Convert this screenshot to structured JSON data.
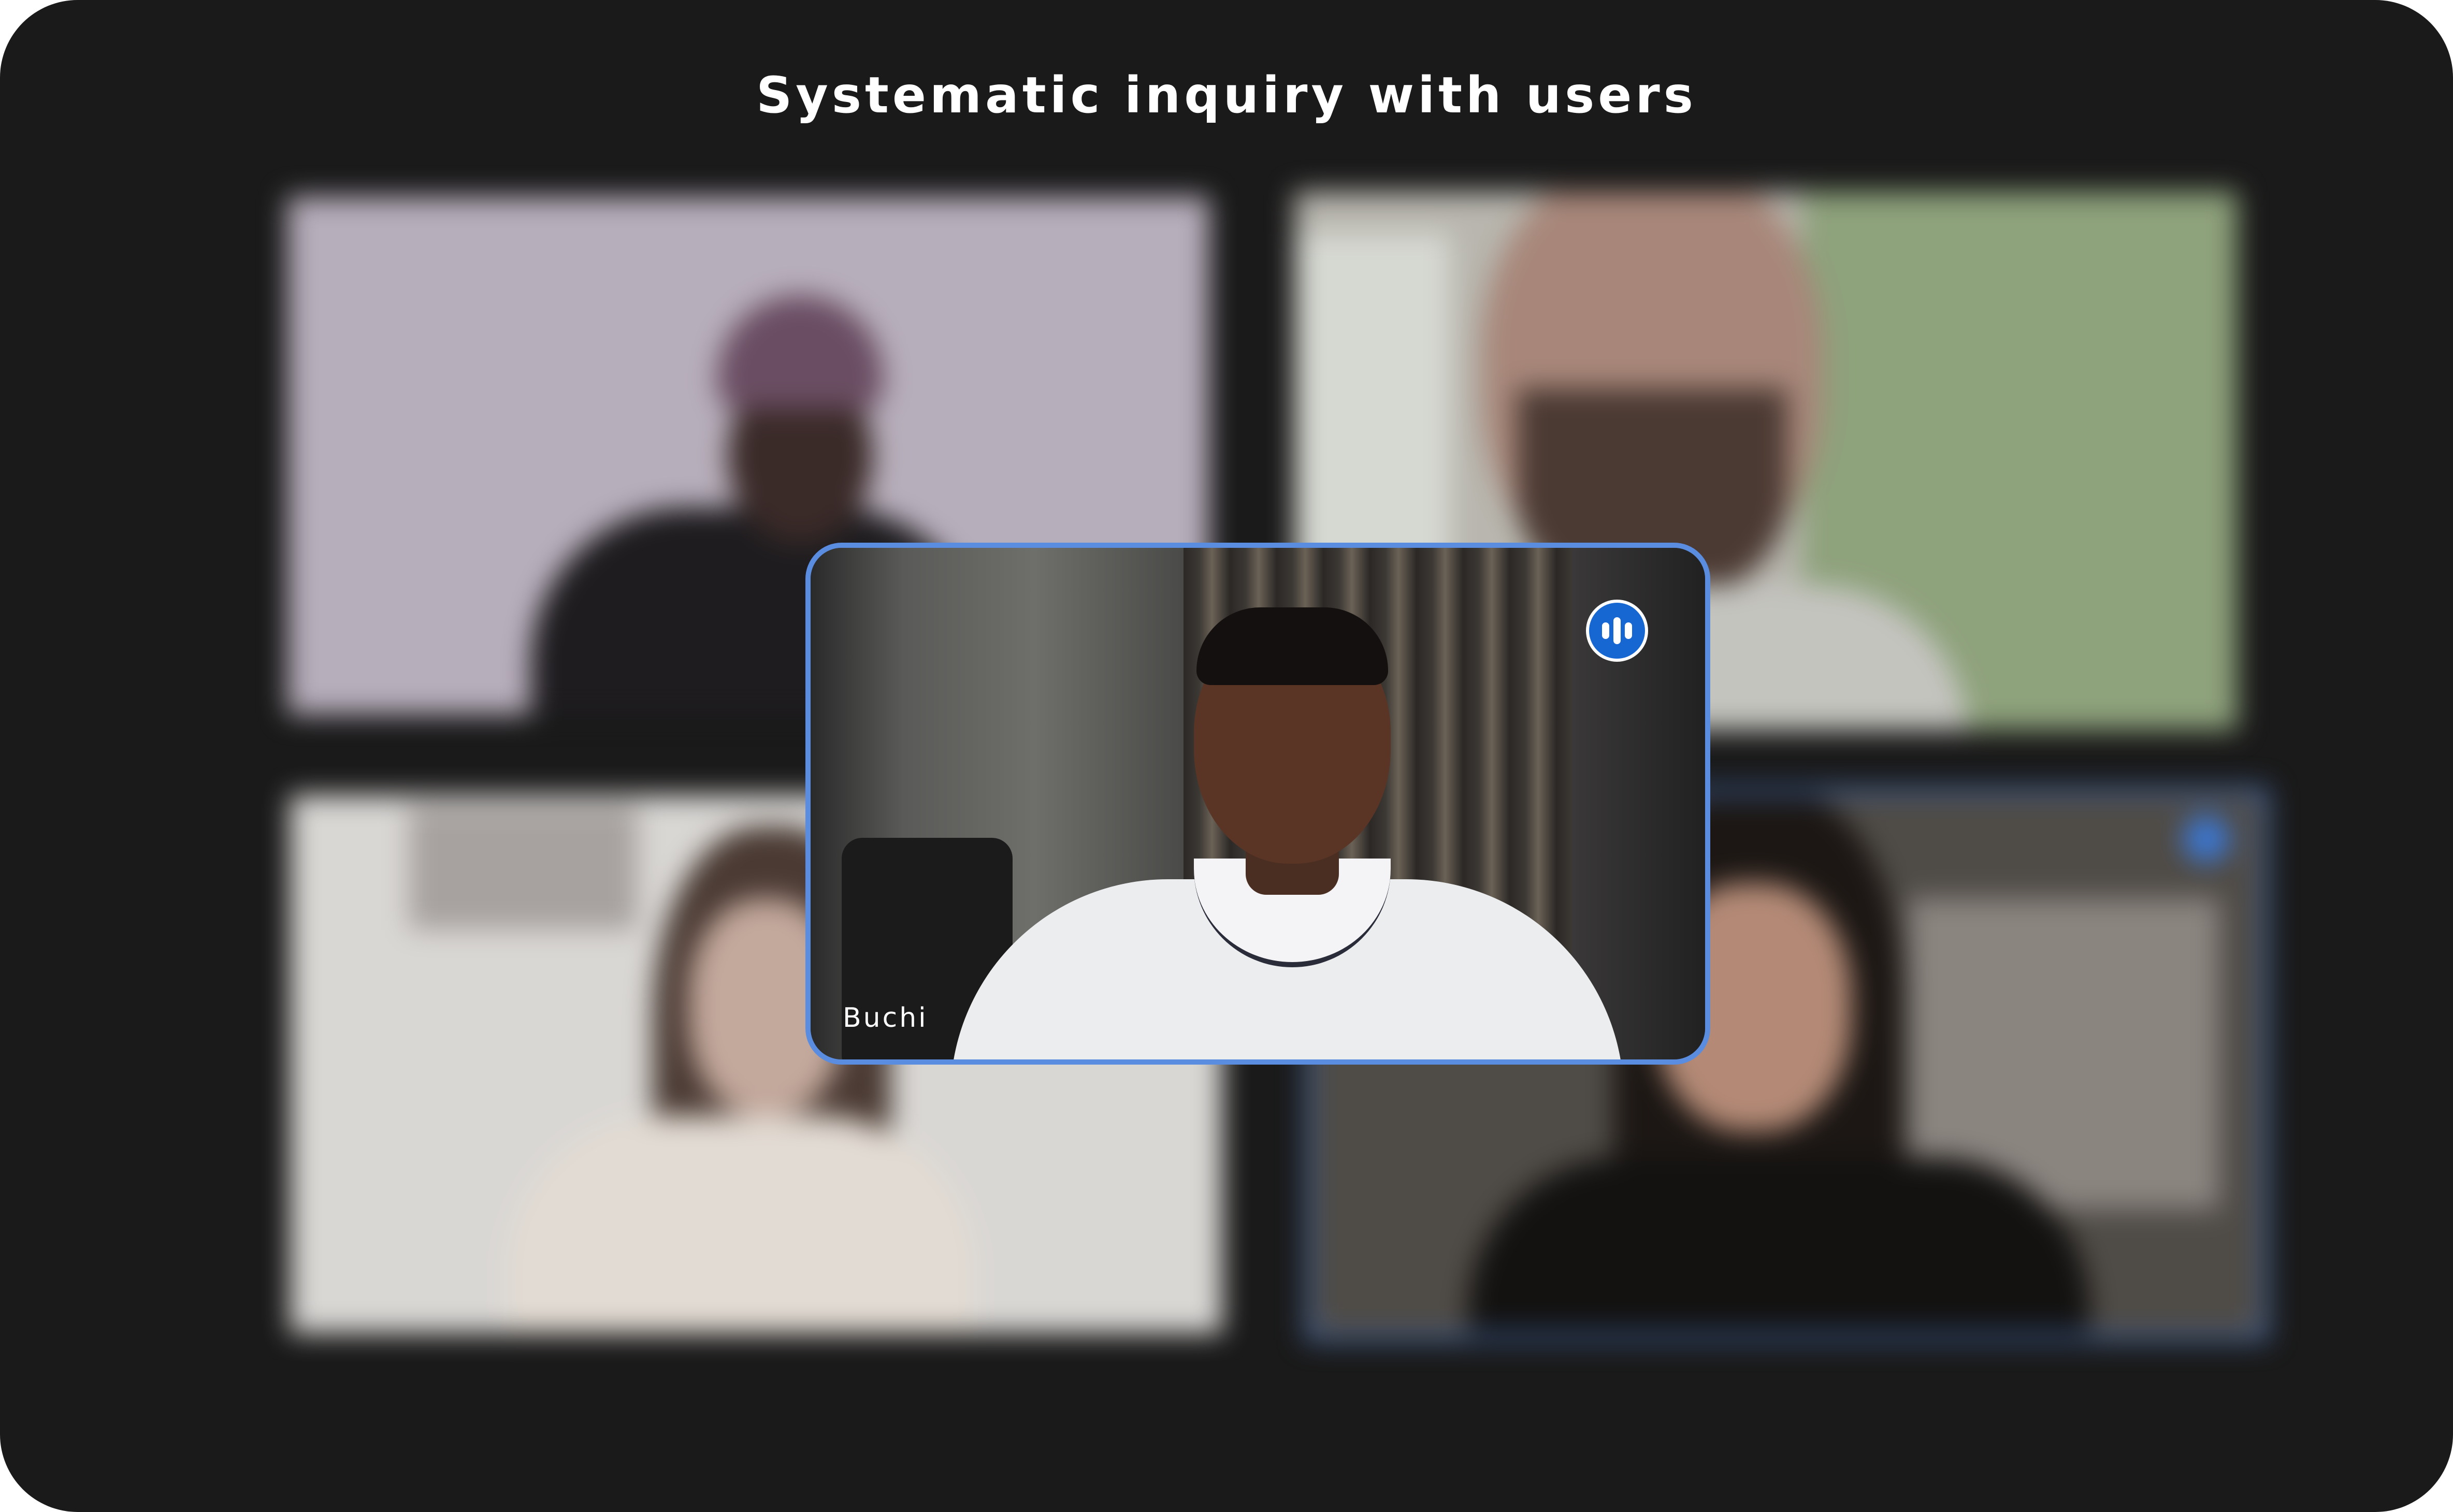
{
  "title": "Systematic inquiry with users",
  "participants": [
    {
      "position": "top-left",
      "blurred": true
    },
    {
      "position": "top-right",
      "blurred": true
    },
    {
      "position": "bottom-left",
      "blurred": true
    },
    {
      "position": "bottom-right",
      "blurred": true,
      "active_speaker_outline": true
    }
  ],
  "focused_participant": {
    "name": "Buchi",
    "speaking_icon": "audio-wave-icon"
  },
  "colors": {
    "background": "#1a1a1a",
    "focus_border": "#5a8ce0",
    "speaking_badge": "#1767d3",
    "active_outline": "#4670b5"
  }
}
